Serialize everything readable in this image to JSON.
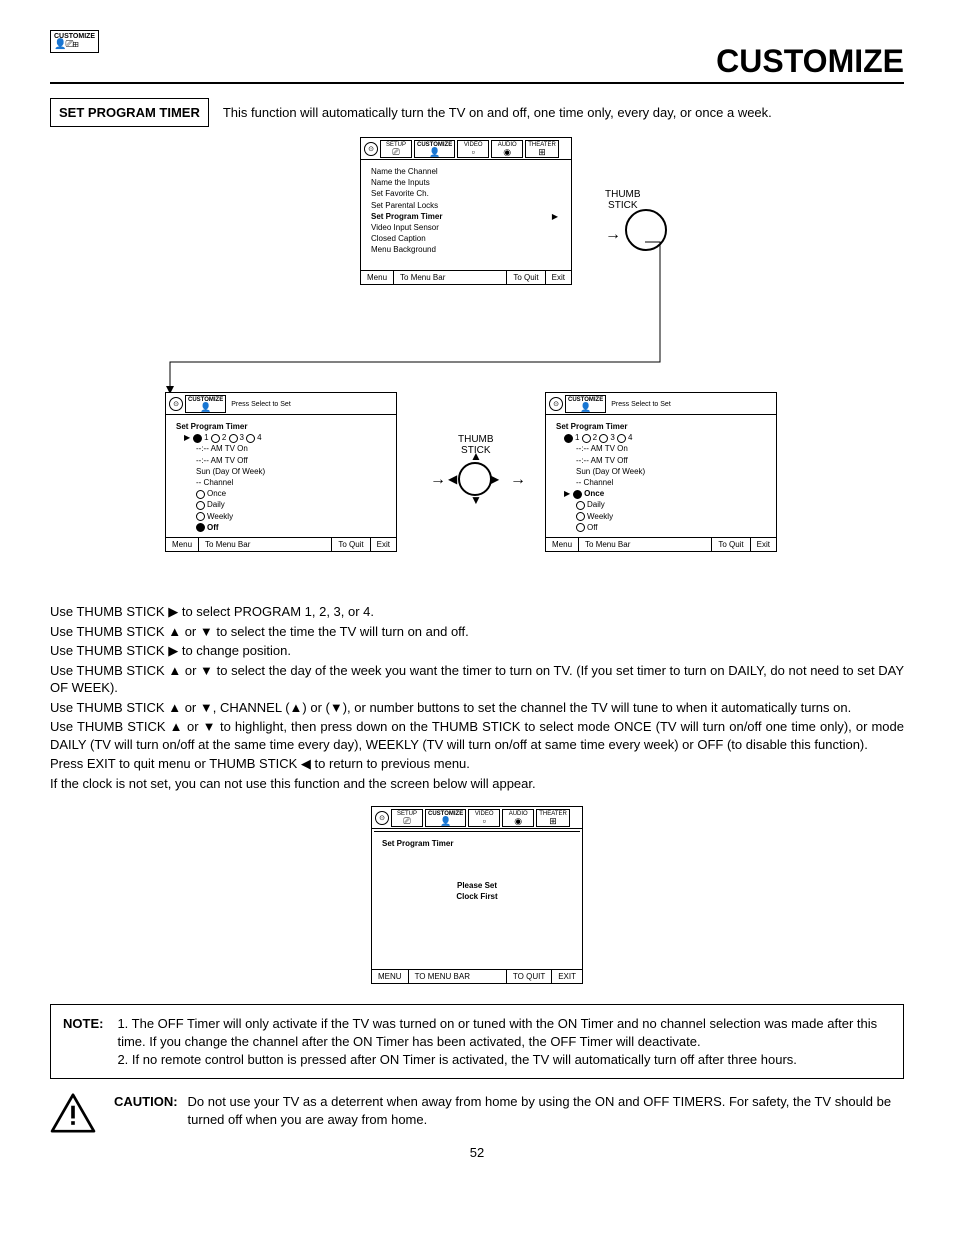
{
  "badge": {
    "label": "CUSTOMIZE"
  },
  "page_title": "CUSTOMIZE",
  "section": {
    "title": "SET PROGRAM TIMER",
    "description": "This function will automatically turn the TV on and off, one time only, every day, or once a week."
  },
  "thumb_label": "THUMB\nSTICK",
  "osd_tabs": {
    "setup": "SETUP",
    "customize": "CUSTOMIZE",
    "video": "VIDEO",
    "audio": "AUDIO",
    "theater": "THEATER"
  },
  "osd_footer": {
    "menu": "Menu",
    "to_menu_bar": "To Menu Bar",
    "to_quit": "To Quit",
    "exit": "Exit"
  },
  "osd_footer_caps": {
    "menu": "MENU",
    "to_menu_bar": "TO MENU BAR",
    "to_quit": "TO QUIT",
    "exit": "EXIT"
  },
  "osd1": {
    "items": [
      "Name the Channel",
      "Name the Inputs",
      "Set Favorite Ch.",
      "Set Parental Locks",
      "Set Program Timer",
      "Video Input Sensor",
      "Closed Caption",
      "Menu Background"
    ],
    "selected_index": 4
  },
  "osd_small_header": "Press Select to Set",
  "osd_timer": {
    "title": "Set Program Timer",
    "nums": [
      "1",
      "2",
      "3",
      "4"
    ],
    "tv_on": "--:-- AM TV On",
    "tv_off": "--:-- AM TV Off",
    "day": "Sun (Day Of Week)",
    "channel": "-- Channel",
    "modes": [
      "Once",
      "Daily",
      "Weekly",
      "Off"
    ]
  },
  "osd2_selected_num": 0,
  "osd2_selected_mode": 3,
  "osd3_selected_mode": 0,
  "clock_osd": {
    "title": "Set Program Timer",
    "msg1": "Please Set",
    "msg2": "Clock First"
  },
  "instructions": [
    "Use THUMB STICK ▶ to select PROGRAM 1, 2, 3, or 4.",
    "Use THUMB STICK ▲ or ▼ to select the time the TV will turn on and off.",
    "Use THUMB STICK ▶ to change position.",
    "Use THUMB STICK ▲ or ▼ to select the day of the week you want the timer to turn on TV. (If you set timer to turn on DAILY, do not need to set DAY OF WEEK).",
    "Use THUMB STICK ▲ or ▼, CHANNEL (▲) or (▼), or number buttons to set the channel the TV will tune to when it automatically turns on.",
    "Use THUMB STICK ▲ or ▼ to highlight, then press down on the THUMB STICK to select mode ONCE (TV will turn on/off one time only), or mode DAILY (TV will turn on/off at the same time every day), WEEKLY (TV will turn on/off at same time every week) or OFF (to disable this function).",
    "Press EXIT to quit menu or THUMB STICK ◀ to return to previous menu.",
    "If the clock is not set, you can not use this function and the screen below will appear."
  ],
  "note": {
    "label": "NOTE:",
    "item1": "1. The OFF Timer will only activate if the TV was turned on or tuned with the ON Timer and no channel selection was made after this time.  If you change the channel after the ON Timer has been activated, the OFF Timer will deactivate.",
    "item2": "2. If no remote control button is pressed after ON Timer is activated, the TV will automatically turn off after three hours."
  },
  "caution": {
    "label": "CAUTION:",
    "text": "Do not use your TV as a deterrent when away from home by using the ON and OFF TIMERS.  For safety, the TV should be turned off when you are away from home."
  },
  "page_number": "52"
}
